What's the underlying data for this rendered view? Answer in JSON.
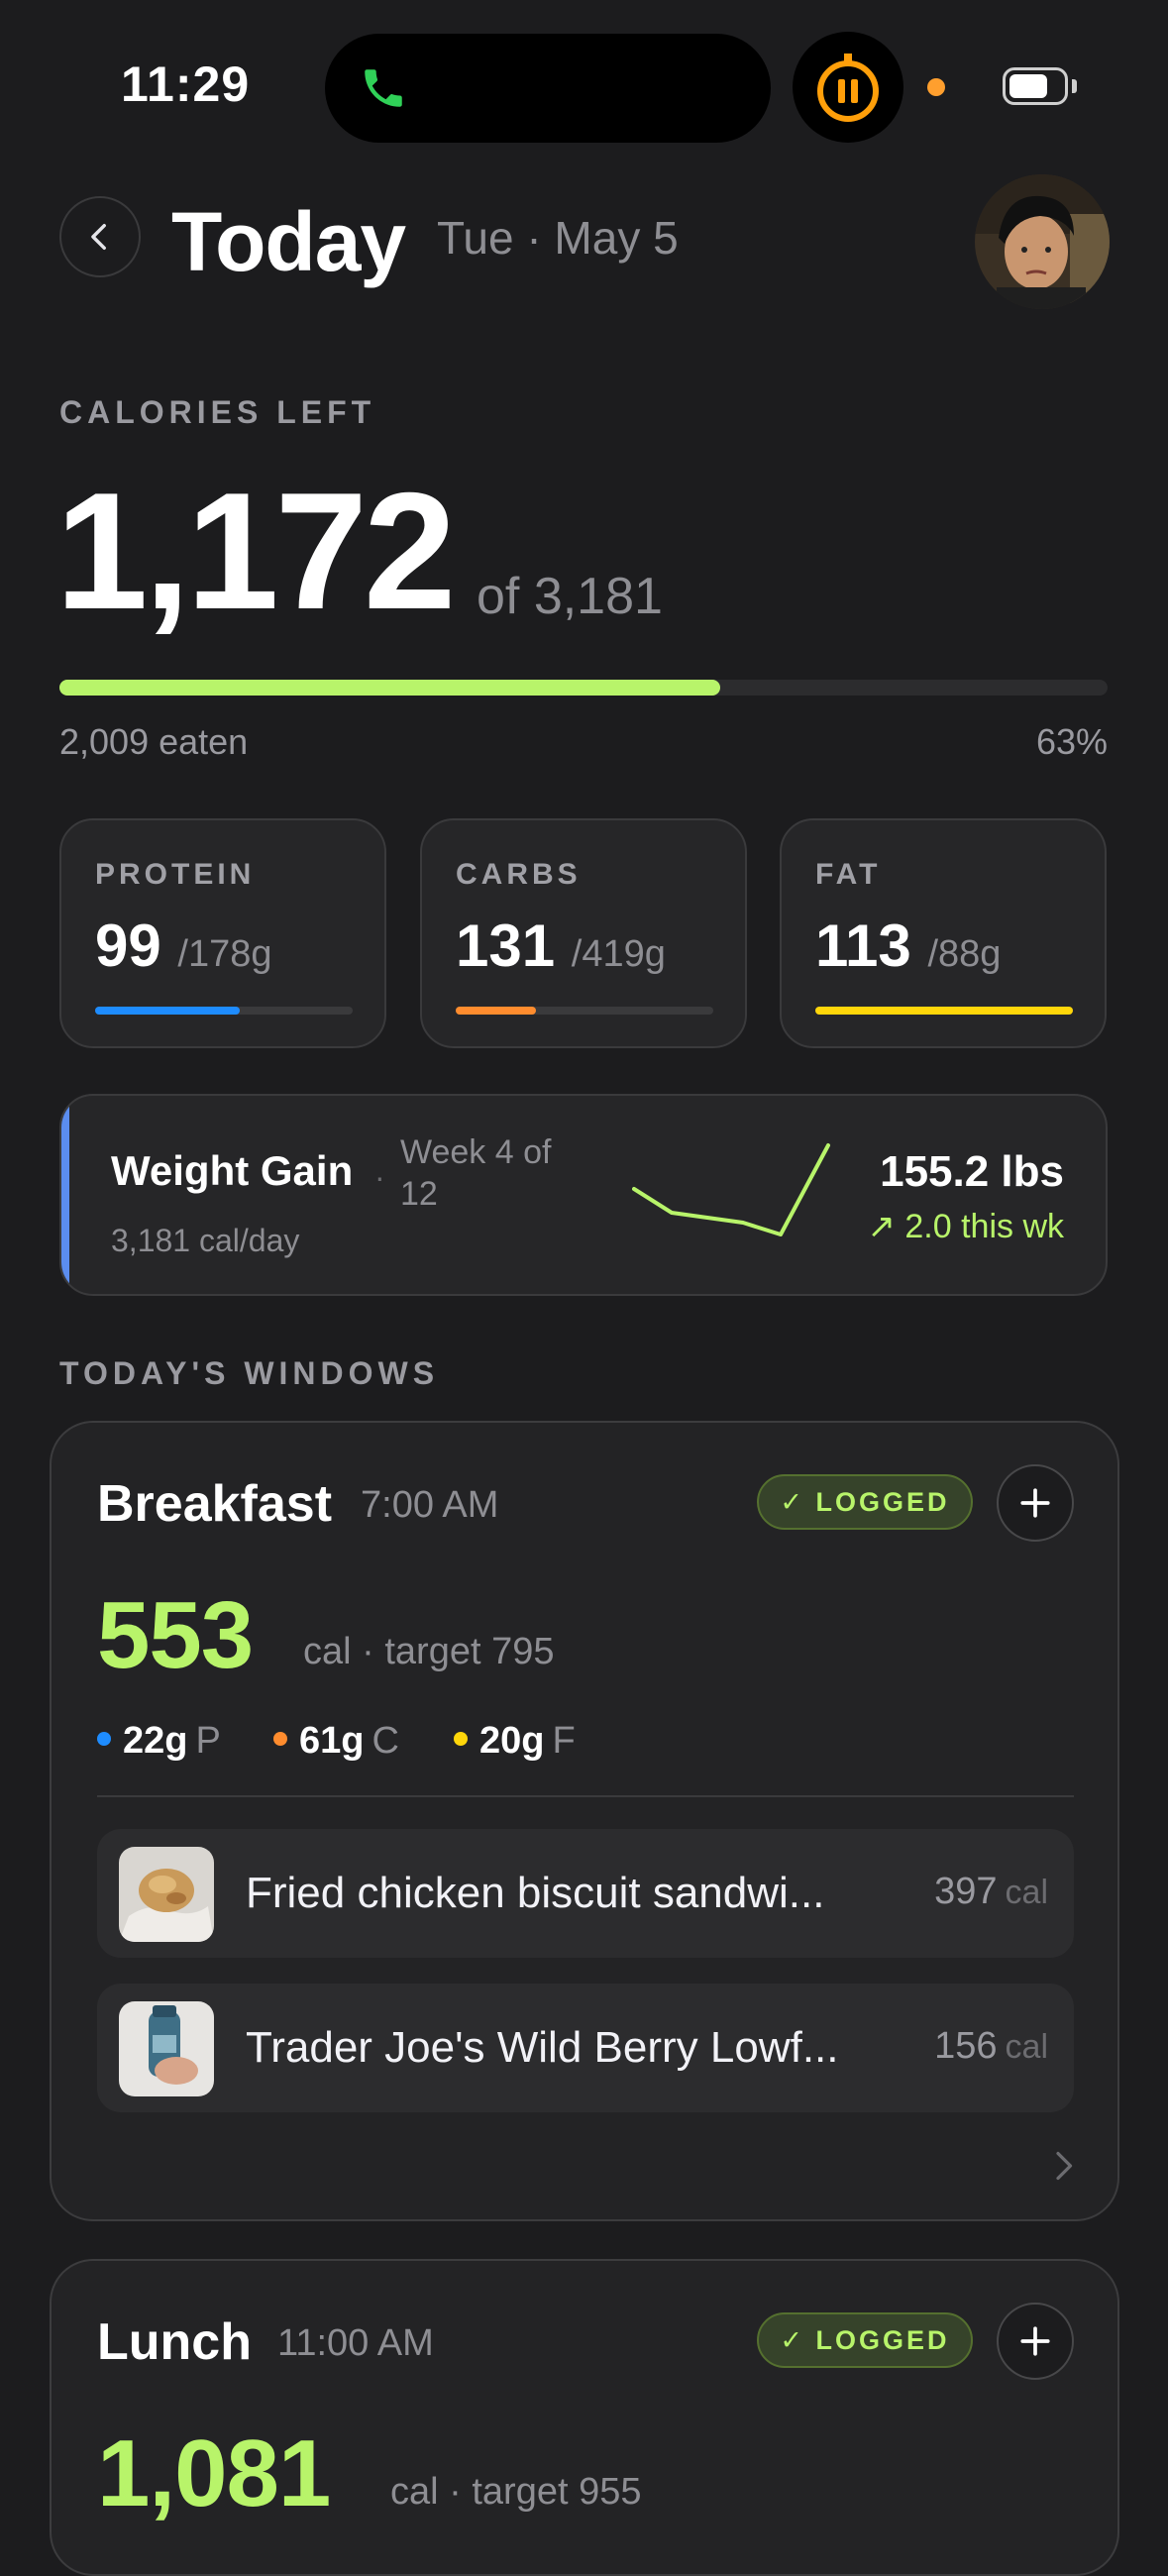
{
  "status_bar": {
    "time": "11:29"
  },
  "header": {
    "title": "Today",
    "date": "Tue · May 5"
  },
  "calories": {
    "label": "CALORIES LEFT",
    "left": "1,172",
    "of_total": "of 3,181",
    "eaten": "2,009 eaten",
    "percent": "63%",
    "progress_fraction": 0.63
  },
  "macros": [
    {
      "label": "PROTEIN",
      "value": "99",
      "target": "/178g",
      "color": "#1e8cff",
      "progress_fraction": 0.56
    },
    {
      "label": "CARBS",
      "value": "131",
      "target": "/419g",
      "color": "#ff8c2e",
      "progress_fraction": 0.31
    },
    {
      "label": "FAT",
      "value": "113",
      "target": "/88g",
      "color": "#ffd60a",
      "progress_fraction": 1.0
    }
  ],
  "goal": {
    "title": "Weight Gain",
    "week": "Week 4 of 12",
    "calories_per_day": "3,181 cal/day",
    "weight": "155.2 lbs",
    "delta": "↗ 2.0 this wk",
    "accent_color": "#5b8def"
  },
  "windows_label": "TODAY'S WINDOWS",
  "windows": [
    {
      "name": "Breakfast",
      "time": "7:00 AM",
      "badge": "✓ LOGGED",
      "calories": "553",
      "target": "cal · target 795",
      "macros": [
        {
          "value": "22g",
          "unit": "P",
          "color": "#1e8cff"
        },
        {
          "value": "61g",
          "unit": "C",
          "color": "#ff8c2e"
        },
        {
          "value": "20g",
          "unit": "F",
          "color": "#ffd60a"
        }
      ],
      "foods": [
        {
          "name": "Fried chicken biscuit sandwi...",
          "calories": "397",
          "unit": "cal"
        },
        {
          "name": "Trader Joe's Wild Berry Lowf...",
          "calories": "156",
          "unit": "cal"
        }
      ]
    },
    {
      "name": "Lunch",
      "time": "11:00 AM",
      "badge": "✓ LOGGED",
      "calories": "1,081",
      "target": "cal · target 955"
    }
  ],
  "colors": {
    "accent_green": "#b8f46a",
    "background": "#1c1c1e"
  },
  "icons": [
    "phone-icon",
    "timer-pause-icon",
    "battery-icon",
    "back-chevron-icon",
    "plus-icon",
    "chevron-right-icon",
    "trend-up-icon"
  ]
}
